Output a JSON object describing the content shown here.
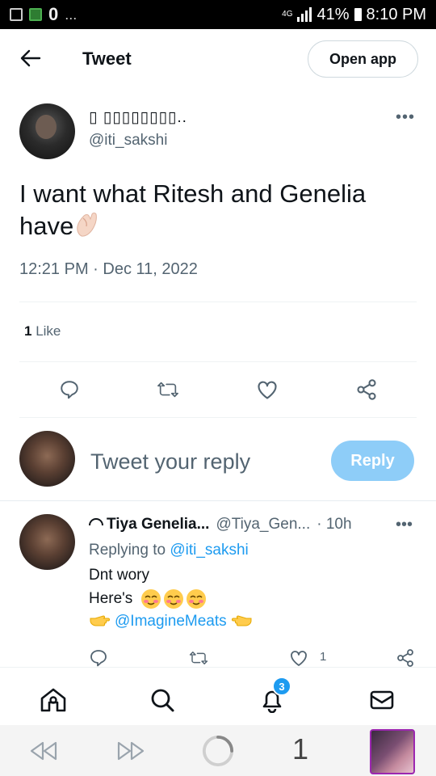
{
  "status_bar": {
    "left_extra": "0",
    "dots": "...",
    "network": "4G",
    "battery": "41%",
    "time": "8:10 PM"
  },
  "header": {
    "title": "Tweet",
    "open_app_label": "Open app"
  },
  "tweet": {
    "author_name": "▯ ▯▯▯▯▯▯▯▯..",
    "author_handle": "@iti_sakshi",
    "text": "I want what Ritesh and Genelia have",
    "text_emoji": "pinched-fingers",
    "timestamp": "12:21 PM · Dec 11, 2022",
    "likes_count": "1",
    "likes_label": " Like",
    "more": "•••"
  },
  "reply_composer": {
    "placeholder": "Tweet your reply",
    "reply_label": "Reply"
  },
  "reply": {
    "name": "Tiya Genelia...",
    "handle": "@Tiya_Gen...",
    "time": "· 10h",
    "more": "•••",
    "replying_prefix": "Replying to ",
    "replying_to": "@iti_sakshi",
    "line1": "Dnt wory",
    "line2": "Here's",
    "line2_emoji": "smiling-face-x3",
    "line3_mention": "@ImagineMeats",
    "like_count": "1"
  },
  "bottom_nav": {
    "items": [
      "home",
      "search",
      "notifications",
      "messages"
    ],
    "notifications_badge": "3"
  },
  "browser_bar": {
    "tab_count": "1"
  },
  "colors": {
    "accent": "#1d9bf0",
    "reply_button": "#8ecdf8",
    "secondary_text": "#536471",
    "primary_text": "#0f1419"
  }
}
